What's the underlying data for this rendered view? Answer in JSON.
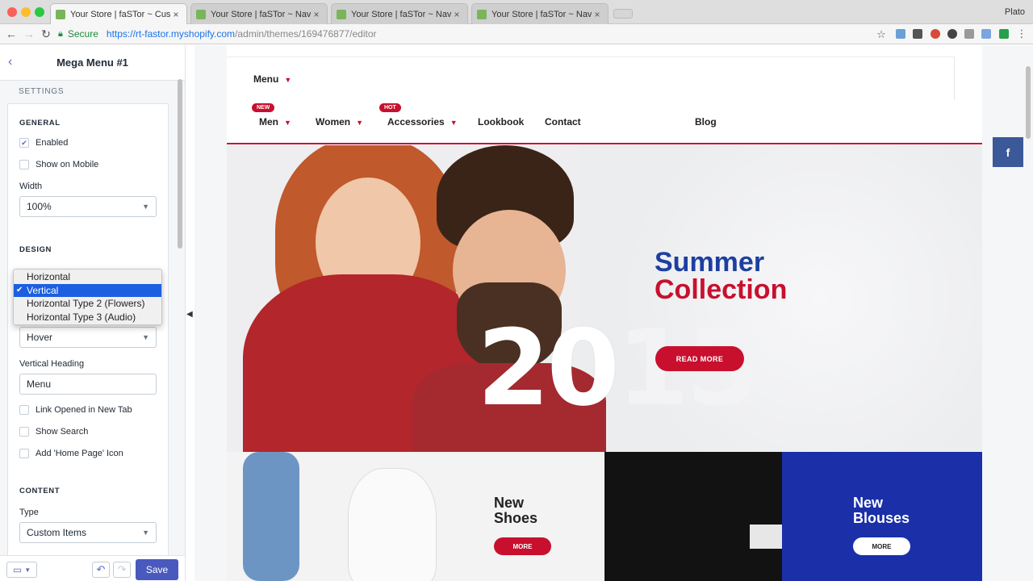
{
  "browser": {
    "tabs": [
      {
        "title": "Your Store | faSTor ~ Customiz",
        "active": true
      },
      {
        "title": "Your Store | faSTor ~ Navigatio",
        "active": false
      },
      {
        "title": "Your Store | faSTor ~ Navigatio",
        "active": false
      },
      {
        "title": "Your Store | faSTor ~ Navigatio",
        "active": false
      }
    ],
    "close_glyph": "×",
    "profile": "Plato",
    "secure_label": "Secure",
    "url_host": "https://rt-fastor.myshopify.com",
    "url_path": "/admin/themes/169476877/editor"
  },
  "sidebar": {
    "title": "Mega Menu #1",
    "settings_label": "SETTINGS",
    "general_label": "GENERAL",
    "enabled_label": "Enabled",
    "show_mobile_label": "Show on Mobile",
    "width_label": "Width",
    "width_value": "100%",
    "design_label": "DESIGN",
    "trigger_value": "Hover",
    "vertical_heading_label": "Vertical Heading",
    "vertical_heading_value": "Menu",
    "link_new_tab_label": "Link Opened in New Tab",
    "show_search_label": "Show Search",
    "home_icon_label": "Add 'Home Page' Icon",
    "content_label": "CONTENT",
    "type_label": "Type",
    "type_value": "Custom Items",
    "save_label": "Save",
    "orientation_options": [
      {
        "label": "Horizontal",
        "selected": false
      },
      {
        "label": "Vertical",
        "selected": true
      },
      {
        "label": "Horizontal Type 2 (Flowers)",
        "selected": false
      },
      {
        "label": "Horizontal Type 3 (Audio)",
        "selected": false
      }
    ]
  },
  "site": {
    "menu_button": "Menu",
    "nav": [
      {
        "label": "Men",
        "badge": "NEW"
      },
      {
        "label": "Women",
        "badge": ""
      },
      {
        "label": "Accessories",
        "badge": "HOT"
      },
      {
        "label": "Lookbook",
        "badge": ""
      },
      {
        "label": "Contact",
        "badge": ""
      },
      {
        "label": "Blog",
        "badge": ""
      }
    ],
    "hero": {
      "line1": "Summer",
      "line2": "Collection",
      "year_a": "20",
      "year_b": "15",
      "cta": "READ MORE"
    },
    "tiles": [
      {
        "title_1": "New",
        "title_2": "Shoes",
        "cta": "MORE"
      },
      {
        "title_1": "New",
        "title_2": "Blouses",
        "cta": "MORE"
      }
    ],
    "social_glyph": "f"
  },
  "colors": {
    "accent_red": "#c8102e",
    "accent_blue": "#1d3fa0",
    "shopify_save": "#4959bd",
    "facebook": "#3b5998"
  }
}
